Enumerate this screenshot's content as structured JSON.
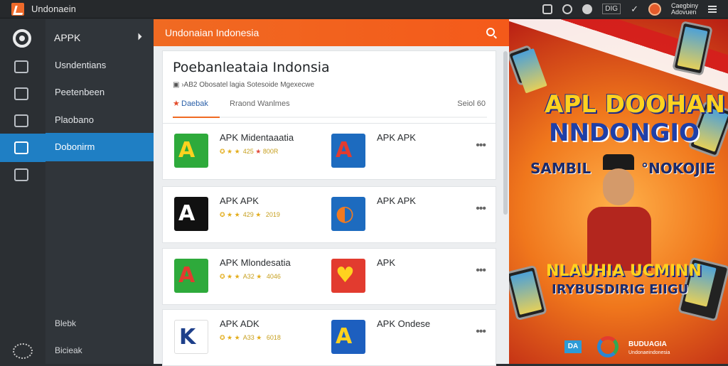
{
  "titlebar": {
    "title": "Undonaein",
    "controls": {
      "box_label": "DIG",
      "check": "✓",
      "user_line1": "Caegbiny",
      "user_line2": "Adovuen"
    }
  },
  "sidebar": {
    "header": "APPK",
    "items": [
      {
        "label": "Usndentians"
      },
      {
        "label": "Peetenbeen"
      },
      {
        "label": "Plaobano"
      },
      {
        "label": "Dobonirm"
      }
    ],
    "footer_items": [
      {
        "label": "Blebk"
      },
      {
        "label": "Bicieak"
      }
    ]
  },
  "main": {
    "topbar_title": "Undonaian Indonesia",
    "info": {
      "heading": "Poebanleataia Indonsia",
      "subtitle": "▣ ›AB2 Obosatel lagia Sotesoide Mgexecwe",
      "tabs": [
        "Daebak",
        "Rraond Wanlmes"
      ],
      "counter": "Seiol  60"
    },
    "cards": [
      {
        "apps": [
          {
            "name": "APK Midentaaatia",
            "icon": "A",
            "icon_color": "#2eaa3b",
            "glyph_color": "#ffd21f",
            "rating_a": "425",
            "rating_b": "800R",
            "meta_star_b": "red"
          },
          {
            "name": "APK APK",
            "icon": "A",
            "icon_color": "#1d6bbf",
            "glyph_color": "#e23b2f",
            "rating_a": "",
            "rating_b": "",
            "meta_star_b": ""
          }
        ]
      },
      {
        "apps": [
          {
            "name": "APK APK",
            "icon": "A",
            "icon_color": "#111111",
            "glyph_color": "#ffffff",
            "rating_a": "429",
            "rating_b": "2019",
            "meta_star_b": ""
          },
          {
            "name": "APK APK",
            "icon": "◐",
            "icon_color": "#1d6bbf",
            "glyph_color": "#f07a22",
            "rating_a": "",
            "rating_b": "",
            "meta_star_b": ""
          }
        ]
      },
      {
        "apps": [
          {
            "name": "APK Mlondesatia",
            "icon": "A",
            "icon_color": "#2eaa3b",
            "glyph_color": "#e23b2f",
            "rating_a": "A32",
            "rating_b": "4046",
            "meta_star_b": ""
          },
          {
            "name": "APK",
            "icon": "♥",
            "icon_color": "#e23b2f",
            "glyph_color": "#ffd21f",
            "rating_a": "",
            "rating_b": "",
            "meta_star_b": ""
          }
        ]
      },
      {
        "apps": [
          {
            "name": "APK ADK",
            "icon": "K",
            "icon_color": "#ffffff",
            "glyph_color": "#1d3f8a",
            "rating_a": "A33",
            "rating_b": "6018",
            "meta_star_b": ""
          },
          {
            "name": "APK Ondese",
            "icon": "A",
            "icon_color": "#1d5fbf",
            "glyph_color": "#ffd21f",
            "rating_a": "",
            "rating_b": "",
            "meta_star_b": ""
          }
        ]
      }
    ]
  },
  "banner": {
    "line1": "APL DOOHAN",
    "line2": "NNDONGIO",
    "line3a": "SAMBIL",
    "line3b": "°NOKOJIE",
    "line4a": "NLAUHIA UCMINN",
    "line4b": "IRYBUSDIRIG EIIGU",
    "footer_logo": "DA",
    "footer_text_1": "BUDUAGIA",
    "footer_text_2": "Undonaeindonesia"
  }
}
